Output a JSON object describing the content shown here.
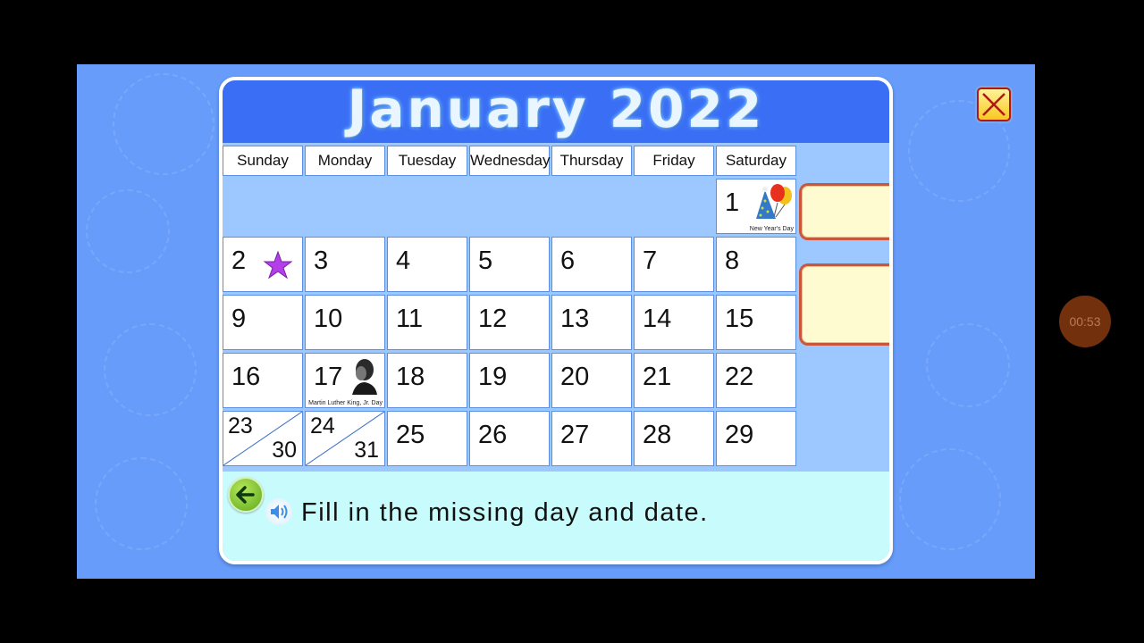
{
  "calendar": {
    "title": "January 2022",
    "weekdays": [
      "Sunday",
      "Monday",
      "Tuesday",
      "Wednesday",
      "Thursday",
      "Friday",
      "Saturday"
    ],
    "holidays": {
      "new_years": "New Year's Day",
      "mlk": "Martin Luther King, Jr. Day"
    },
    "rows": [
      [
        null,
        null,
        null,
        null,
        null,
        null,
        "1"
      ],
      [
        "2",
        "3",
        "4",
        "5",
        "6",
        "7",
        "8"
      ],
      [
        "9",
        "10",
        "11",
        "12",
        "13",
        "14",
        "15"
      ],
      [
        "16",
        "17",
        "18",
        "19",
        "20",
        "21",
        "22"
      ],
      [
        "23/30",
        "24/31",
        "25",
        "26",
        "27",
        "28",
        "29"
      ]
    ],
    "split_cells": {
      "sun_top": "23",
      "sun_bottom": "30",
      "mon_top": "24",
      "mon_bottom": "31"
    }
  },
  "answer_boxes": [
    "",
    ""
  ],
  "instruction": "Fill in the missing day and date.",
  "timer": "00:53",
  "icons": {
    "back": "back-arrow-icon",
    "speaker": "speaker-icon",
    "close": "close-icon",
    "star": "star-icon"
  },
  "colors": {
    "background": "#679cfb",
    "header": "#3a6ef5",
    "grid": "#9cc8ff",
    "instruction_area": "#c8fcfc",
    "answer_box": "#fffbd0",
    "star": "#b23fe8"
  }
}
